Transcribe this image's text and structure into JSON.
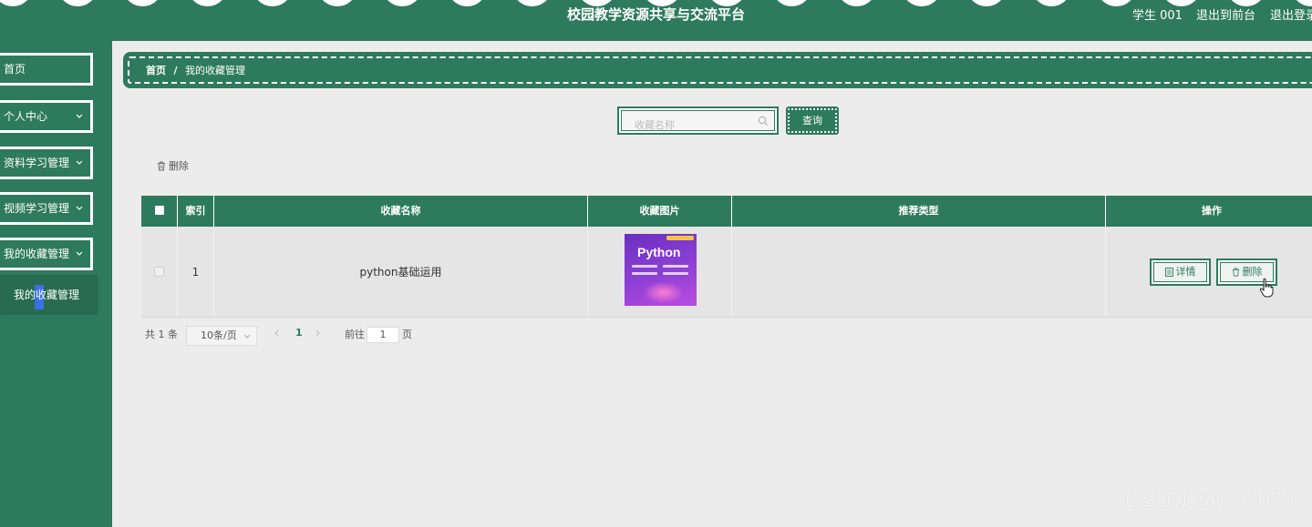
{
  "header": {
    "title": "校园教学资源共享与交流平台",
    "user": "学生 001",
    "to_front": "退出到前台",
    "logout": "退出登录"
  },
  "sidebar": {
    "items": [
      {
        "label": "首页"
      },
      {
        "label": "个人中心"
      },
      {
        "label": "资料学习管理"
      },
      {
        "label": "视频学习管理"
      },
      {
        "label": "我的收藏管理"
      }
    ],
    "submenu_label": "我的收藏管理"
  },
  "breadcrumb": {
    "home": "首页",
    "sep": "/",
    "current": "我的收藏管理"
  },
  "search": {
    "placeholder": "收藏名称",
    "button": "查询"
  },
  "toolbar": {
    "delete_label": "删除"
  },
  "table": {
    "columns": [
      "索引",
      "收藏名称",
      "收藏图片",
      "推荐类型",
      "操作"
    ],
    "rows": [
      {
        "index": "1",
        "name": "python基础运用",
        "type": ""
      }
    ],
    "detail_label": "详情",
    "delete_label": "删除"
  },
  "thumbnail_text": "Python",
  "pagination": {
    "total": "共 1 条",
    "page_size": "10条/页",
    "current_page": "1",
    "goto_label": "前往",
    "goto_value": "1",
    "page_unit": "页"
  },
  "watermark": "CSDN @CK3039",
  "colors": {
    "primary": "#2e7a5e",
    "highlight": "#3b6fe6"
  }
}
